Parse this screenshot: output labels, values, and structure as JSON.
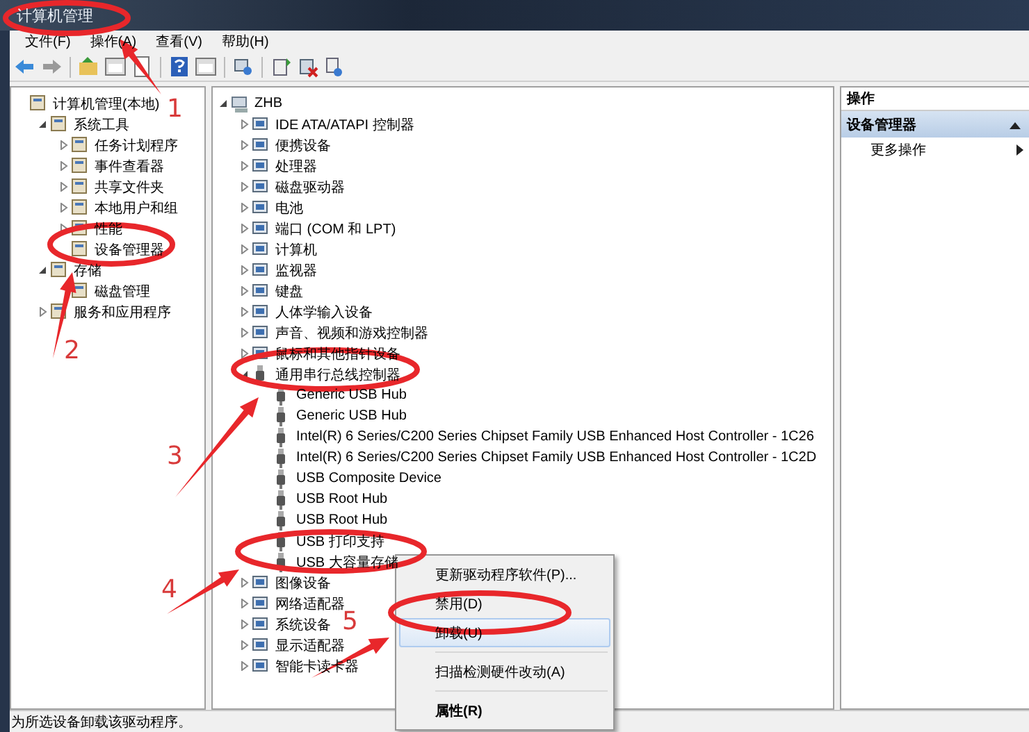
{
  "window": {
    "title": "计算机管理"
  },
  "menu_bar": [
    "文件(F)",
    "操作(A)",
    "查看(V)",
    "帮助(H)"
  ],
  "console_tree": [
    {
      "label": "计算机管理(本地)",
      "children": [
        {
          "label": "系统工具",
          "expanded": true,
          "children": [
            {
              "label": "任务计划程序",
              "expanded": false
            },
            {
              "label": "事件查看器",
              "expanded": false
            },
            {
              "label": "共享文件夹",
              "expanded": false
            },
            {
              "label": "本地用户和组",
              "expanded": false
            },
            {
              "label": "性能",
              "expanded": false
            },
            {
              "label": "设备管理器"
            }
          ]
        },
        {
          "label": "存储",
          "expanded": true,
          "children": [
            {
              "label": "磁盘管理"
            }
          ]
        },
        {
          "label": "服务和应用程序",
          "expanded": false
        }
      ]
    }
  ],
  "device_tree": [
    {
      "label": "ZHB",
      "kind": "computer",
      "expanded": true,
      "children": [
        {
          "label": "IDE ATA/ATAPI 控制器",
          "kind": "device",
          "expanded": false
        },
        {
          "label": "便携设备",
          "kind": "device",
          "expanded": false
        },
        {
          "label": "处理器",
          "kind": "device",
          "expanded": false
        },
        {
          "label": "磁盘驱动器",
          "kind": "device",
          "expanded": false
        },
        {
          "label": "电池",
          "kind": "device",
          "expanded": false
        },
        {
          "label": "端口 (COM 和 LPT)",
          "kind": "device",
          "expanded": false
        },
        {
          "label": "计算机",
          "kind": "device",
          "expanded": false
        },
        {
          "label": "监视器",
          "kind": "device",
          "expanded": false
        },
        {
          "label": "键盘",
          "kind": "device",
          "expanded": false
        },
        {
          "label": "人体学输入设备",
          "kind": "device",
          "expanded": false
        },
        {
          "label": "声音、视频和游戏控制器",
          "kind": "device",
          "expanded": false
        },
        {
          "label": "鼠标和其他指针设备",
          "kind": "device",
          "expanded": false
        },
        {
          "label": "通用串行总线控制器",
          "kind": "usb",
          "expanded": true,
          "children": [
            {
              "label": "Generic USB Hub",
              "kind": "usb"
            },
            {
              "label": "Generic USB Hub",
              "kind": "usb"
            },
            {
              "label": "Intel(R) 6 Series/C200 Series Chipset Family USB Enhanced Host Controller - 1C26",
              "kind": "usb"
            },
            {
              "label": "Intel(R) 6 Series/C200 Series Chipset Family USB Enhanced Host Controller - 1C2D",
              "kind": "usb"
            },
            {
              "label": "USB Composite Device",
              "kind": "usb"
            },
            {
              "label": "USB Root Hub",
              "kind": "usb"
            },
            {
              "label": "USB Root Hub",
              "kind": "usb"
            },
            {
              "label": "USB 打印支持",
              "kind": "usb"
            },
            {
              "label": "USB 大容量存储",
              "kind": "usb"
            }
          ]
        },
        {
          "label": "图像设备",
          "kind": "device",
          "expanded": false
        },
        {
          "label": "网络适配器",
          "kind": "device",
          "expanded": false
        },
        {
          "label": "系统设备",
          "kind": "device",
          "expanded": false
        },
        {
          "label": "显示适配器",
          "kind": "device",
          "expanded": false
        },
        {
          "label": "智能卡读卡器",
          "kind": "device",
          "expanded": false
        }
      ]
    }
  ],
  "context_menu": {
    "groups": [
      [
        {
          "label": "更新驱动程序软件(P)...",
          "selected": false,
          "default": false
        },
        {
          "label": "禁用(D)",
          "selected": false,
          "default": false
        },
        {
          "label": "卸载(U)",
          "selected": true,
          "default": false
        }
      ],
      [
        {
          "label": "扫描检测硬件改动(A)",
          "selected": false,
          "default": false
        }
      ],
      [
        {
          "label": "属性(R)",
          "selected": false,
          "default": true
        }
      ]
    ]
  },
  "actions_pane": {
    "header": "操作",
    "section": {
      "title": "设备管理器",
      "expanded": true
    },
    "items": [
      "更多操作"
    ]
  },
  "status_bar": "为所选设备卸载该驱动程序。",
  "annotations": [
    {
      "label": "1"
    },
    {
      "label": "2"
    },
    {
      "label": "3"
    },
    {
      "label": "4"
    },
    {
      "label": "5"
    }
  ]
}
